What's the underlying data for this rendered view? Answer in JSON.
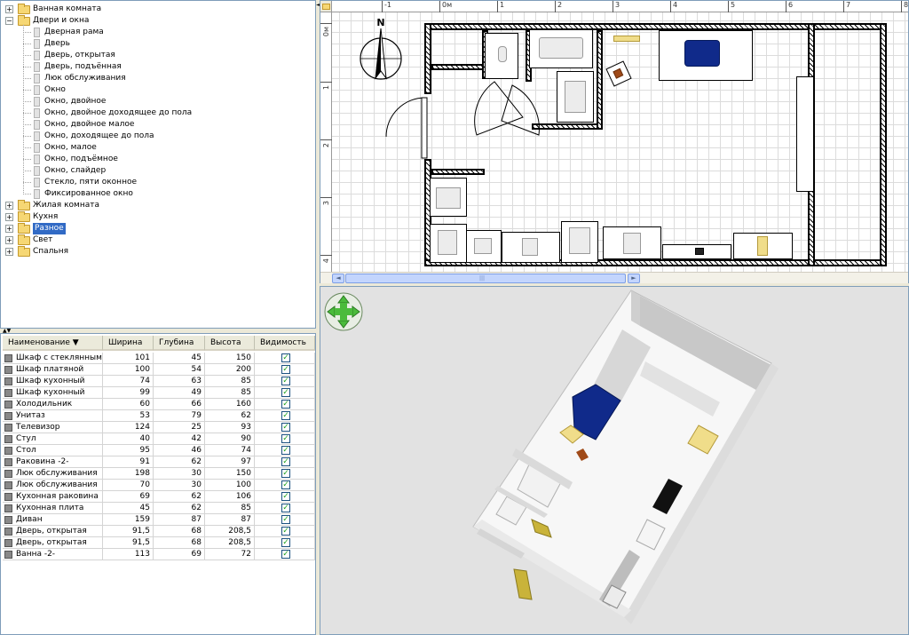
{
  "catalog": {
    "groups": [
      {
        "label": "Ванная комната",
        "expanded": false
      },
      {
        "label": "Двери и окна",
        "expanded": true,
        "items": [
          "Дверная рама",
          "Дверь",
          "Дверь, открытая",
          "Дверь, подъённая",
          "Люк обслуживания",
          "Окно",
          "Окно, двойное",
          "Окно, двойное доходящее до пола",
          "Окно, двойное малое",
          "Окно, доходящее до пола",
          "Окно, малое",
          "Окно, подъёмное",
          "Окно, слайдер",
          "Стекло, пяти оконное",
          "Фиксированное окно"
        ]
      },
      {
        "label": "Жилая комната",
        "expanded": false
      },
      {
        "label": "Кухня",
        "expanded": false
      },
      {
        "label": "Разное",
        "expanded": false,
        "selected": true
      },
      {
        "label": "Свет",
        "expanded": false
      },
      {
        "label": "Спальня",
        "expanded": false
      }
    ],
    "expander_plus": "+",
    "expander_minus": "−"
  },
  "furniture_table": {
    "columns": [
      "Наименование ▼",
      "Ширина",
      "Глубина",
      "Высота",
      "Видимость"
    ],
    "rows": [
      {
        "name": "Шкаф с стеклянным...",
        "width": "101",
        "depth": "45",
        "height": "150",
        "visible": true
      },
      {
        "name": "Шкаф платяной",
        "width": "100",
        "depth": "54",
        "height": "200",
        "visible": true
      },
      {
        "name": "Шкаф кухонный",
        "width": "74",
        "depth": "63",
        "height": "85",
        "visible": true
      },
      {
        "name": "Шкаф кухонный",
        "width": "99",
        "depth": "49",
        "height": "85",
        "visible": true
      },
      {
        "name": "Холодильник",
        "width": "60",
        "depth": "66",
        "height": "160",
        "visible": true
      },
      {
        "name": "Унитаз",
        "width": "53",
        "depth": "79",
        "height": "62",
        "visible": true
      },
      {
        "name": "Телевизор",
        "width": "124",
        "depth": "25",
        "height": "93",
        "visible": true
      },
      {
        "name": "Стул",
        "width": "40",
        "depth": "42",
        "height": "90",
        "visible": true
      },
      {
        "name": "Стол",
        "width": "95",
        "depth": "46",
        "height": "74",
        "visible": true
      },
      {
        "name": "Раковина -2-",
        "width": "91",
        "depth": "62",
        "height": "97",
        "visible": true
      },
      {
        "name": "Люк обслуживания",
        "width": "198",
        "depth": "30",
        "height": "150",
        "visible": true
      },
      {
        "name": "Люк обслуживания",
        "width": "70",
        "depth": "30",
        "height": "100",
        "visible": true
      },
      {
        "name": "Кухонная раковина",
        "width": "69",
        "depth": "62",
        "height": "106",
        "visible": true
      },
      {
        "name": "Кухонная плита",
        "width": "45",
        "depth": "62",
        "height": "85",
        "visible": true
      },
      {
        "name": "Диван",
        "width": "159",
        "depth": "87",
        "height": "87",
        "visible": true
      },
      {
        "name": "Дверь, открытая",
        "width": "91,5",
        "depth": "68",
        "height": "208,5",
        "visible": true
      },
      {
        "name": "Дверь, открытая",
        "width": "91,5",
        "depth": "68",
        "height": "208,5",
        "visible": true
      },
      {
        "name": "Ванна -2-",
        "width": "113",
        "depth": "69",
        "height": "72",
        "visible": true
      }
    ],
    "check_mark": "✓"
  },
  "plan": {
    "h_ruler_labels": [
      "-1",
      "0м",
      "1",
      "2",
      "3",
      "4",
      "5",
      "6",
      "7",
      "8"
    ],
    "v_ruler_labels": [
      "0м",
      "1",
      "2",
      "3",
      "4"
    ],
    "compass_label": "N",
    "scroll_left": "◄",
    "scroll_right": "►"
  },
  "view3d": {
    "nav_control": "navigation-arrows"
  },
  "colors": {
    "selection": "#316ac5",
    "sofa": "#102a8a",
    "wood": "#f0dd8a",
    "chair": "#a04a18"
  }
}
